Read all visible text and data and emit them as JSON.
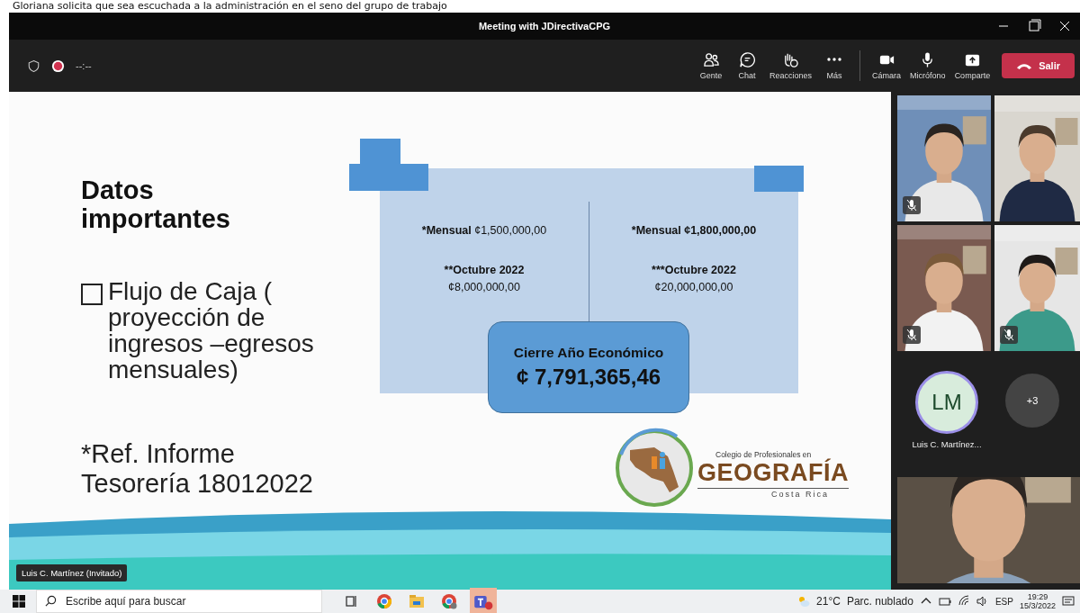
{
  "caption": "Gloriana solicita que sea escuchada a la administración en el seno del grupo de trabajo",
  "window": {
    "title": "Meeting with JDirectivaCPG"
  },
  "toolbar": {
    "timer": "--:--",
    "recording": true,
    "buttons": [
      {
        "kind": "people",
        "label": "Gente"
      },
      {
        "kind": "chat",
        "label": "Chat"
      },
      {
        "kind": "reactions",
        "label": "Reacciones"
      },
      {
        "kind": "more",
        "label": "Más"
      },
      {
        "kind": "camera",
        "label": "Cámara"
      },
      {
        "kind": "mic",
        "label": "Micrófono"
      },
      {
        "kind": "share",
        "label": "Comparte"
      }
    ],
    "leave": "Salir"
  },
  "slide": {
    "title": "Datos importantes",
    "bullet": "Flujo de Caja ( proyección de ingresos –egresos mensuales)",
    "reference": "*Ref. Informe Tesorería 18012022",
    "columns": [
      {
        "monthly_label": "*Mensual",
        "monthly_value": "¢1,500,000,00",
        "monthly_value_bold": false,
        "period": "**Octubre 2022",
        "period_value": "¢8,000,000,00"
      },
      {
        "monthly_label": "*Mensual",
        "monthly_value": "¢1,800,000,00",
        "monthly_value_bold": true,
        "period": "***Octubre 2022",
        "period_value": "¢20,000,000,00"
      }
    ],
    "total_label": "Cierre Año Económico",
    "total_value": "¢ 7,791,365,46",
    "logo": {
      "top": "Colegio de Profesionales en",
      "name": "GEOGRAFÍA",
      "bottom": "Costa Rica"
    }
  },
  "presenter": "Luis C. Martínez (Invitado)",
  "participants": [
    {
      "muted": true
    },
    {
      "muted": false
    },
    {
      "muted": true
    },
    {
      "muted": true
    }
  ],
  "avatar": {
    "initials": "LM",
    "name": "Luis C. Martínez..."
  },
  "overflow": "+3",
  "taskbar": {
    "search_placeholder": "Escribe aquí para buscar",
    "temperature": "21°C",
    "weather": "Parc. nublado",
    "language": "ESP",
    "time": "19:29",
    "date": "15/3/2022"
  }
}
